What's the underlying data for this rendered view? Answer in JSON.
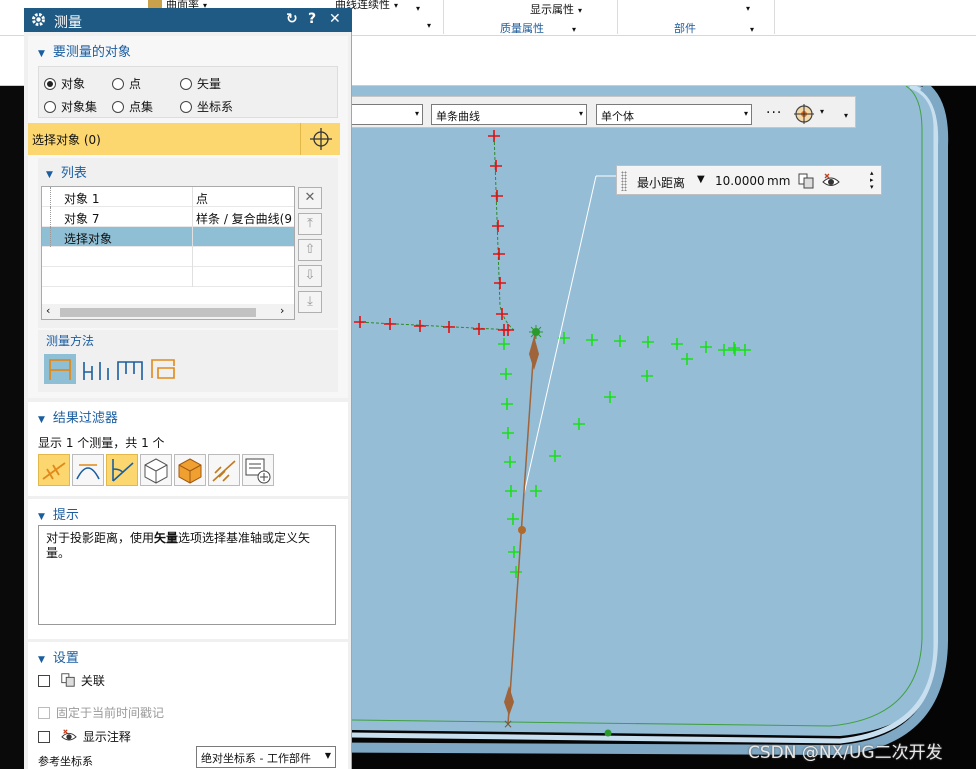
{
  "ribbon": {
    "items": [
      {
        "label": "曲面率",
        "arrow": "▾"
      },
      {
        "label": "曲线连续性",
        "arrow": "▾"
      },
      {
        "label": "显示属性",
        "arrow": "▾"
      },
      {
        "label": "质量属性",
        "arrow": "▾"
      },
      {
        "label": "部件",
        "arrow": "▾"
      }
    ],
    "extra_arrows": [
      "▾",
      "▾",
      "▾",
      "▾"
    ]
  },
  "selection_bar": {
    "filter_value": "",
    "curve_rule": "单条曲线",
    "body_rule": "单个体",
    "more": "···",
    "dropdown_glyph": "▾"
  },
  "dimension_box": {
    "label": "最小距离",
    "arrow": "▼",
    "value": "10.0000",
    "unit": "mm"
  },
  "dialog": {
    "title": "测量",
    "controls": {
      "reset": "↻",
      "help": "?",
      "close": "✕"
    },
    "section_objects": {
      "header": "要测量的对象",
      "radios": [
        {
          "label": "对象",
          "checked": true
        },
        {
          "label": "点",
          "checked": false
        },
        {
          "label": "矢量",
          "checked": false
        },
        {
          "label": "对象集",
          "checked": false
        },
        {
          "label": "点集",
          "checked": false
        },
        {
          "label": "坐标系",
          "checked": false
        }
      ],
      "select_label": "选择对象 (0)",
      "list_header": "列表",
      "list_rows": [
        {
          "name": "对象 1",
          "type": "点"
        },
        {
          "name": "对象 7",
          "type": "样条 / 复合曲线(9"
        },
        {
          "name": "选择对象",
          "type": ""
        },
        {
          "name": "",
          "type": ""
        },
        {
          "name": "",
          "type": ""
        }
      ],
      "list_buttons": [
        "✕",
        "⤒",
        "⇧",
        "⇩",
        "⤓"
      ],
      "scroll_left": "‹",
      "scroll_right": "›",
      "method_header": "测量方法"
    },
    "section_filter": {
      "header": "结果过滤器",
      "summary": "显示 1 个测量，共 1 个"
    },
    "section_hint": {
      "header": "提示",
      "text_before": "对于投影距离，使用",
      "text_bold": "矢量",
      "text_after": "选项选择基准轴或定义矢量。"
    },
    "section_settings": {
      "header": "设置",
      "associative": "关联",
      "fix_timestamp": "固定于当前时间戳记",
      "show_annotation": "显示注释",
      "ref_csys_label": "参考坐标系",
      "ref_csys_value": "绝对坐标系 - 工作部件"
    }
  },
  "colors": {
    "title_bar": "#1e5a84",
    "header_text": "#1b5ea0",
    "highlight": "#fcd770",
    "model_face": "#96bdd6",
    "red_points": "#e01010",
    "green_points": "#19e019",
    "measure_line": "#a0643a"
  },
  "watermark": "CSDN @NX/UG二次开发"
}
